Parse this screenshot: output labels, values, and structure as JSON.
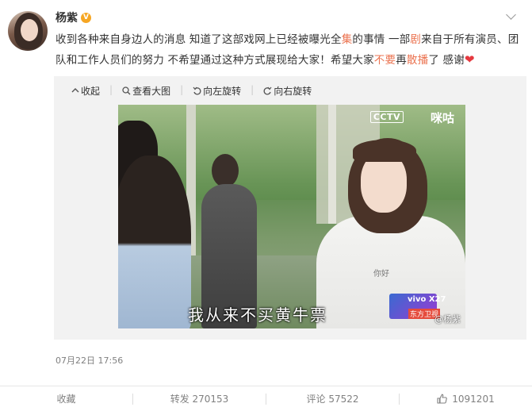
{
  "post": {
    "username": "杨紫",
    "verified_badge": "V",
    "text_part1": "收到各种来自身边人的消息 知道了这部戏网上已经被曝光全",
    "text_hl1": "集",
    "text_part2": "的事情 一部",
    "text_hl2": "剧",
    "text_part3": "来自于所有演员、团队和工作人员们的努力 不希望通过这种方式展现给大家！希望大家",
    "text_hl3": "不要",
    "text_part4": "再",
    "text_hl4": "散播",
    "text_part5": "了 感谢",
    "emoji": "❤",
    "timestamp": "07月22日 17:56"
  },
  "toolbar": {
    "collapse": "收起",
    "view_large": "查看大图",
    "rotate_left": "向左旋转",
    "rotate_right": "向右旋转"
  },
  "media": {
    "subtitle": "我从来不买黄牛票",
    "logo_cctv": "CCTV",
    "logo_migu": "咪咕",
    "ad_text": "vivo X27",
    "ad_channel": "东方卫视",
    "shirt_text": "你好",
    "watermark": "@杨紫"
  },
  "footer": {
    "favorite": "收藏",
    "repost": "转发 270153",
    "comment": "评论 57522",
    "like": "1091201"
  },
  "colors": {
    "highlight": "#eb7350",
    "heart": "#e5393f"
  },
  "icons": {
    "collapse": "collapse-arrow-icon",
    "zoom": "magnifier-icon",
    "rotate_left": "rotate-left-icon",
    "rotate_right": "rotate-right-icon",
    "like": "thumbs-up-icon"
  }
}
